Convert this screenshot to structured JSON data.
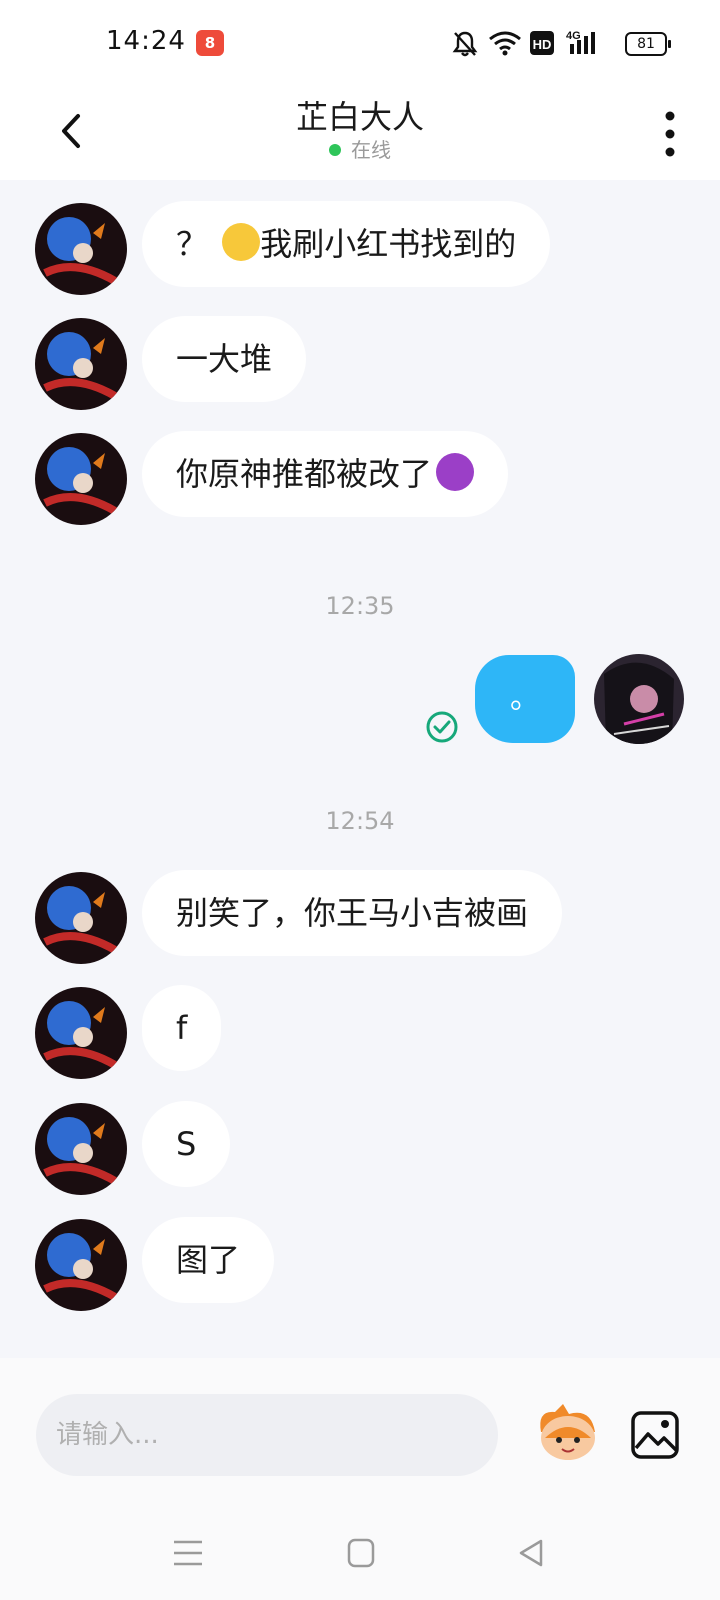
{
  "status_bar": {
    "time": "14:24",
    "app_badge": "8",
    "battery": "81",
    "network": "4G"
  },
  "header": {
    "title": "芷白大人",
    "presence": "在线"
  },
  "messages_group1": [
    {
      "text_before": "？",
      "emoji": "fearful-face",
      "text_after": "我刷小红书找到的"
    },
    {
      "text": "一大堆"
    },
    {
      "text": "你原神推都被改了",
      "emoji": "angry-devil-face"
    }
  ],
  "time1": "12:35",
  "sent_message": {
    "text": "。",
    "status": "sent",
    "status_color": "#16a87a",
    "bubble_color": "#2eb6f7"
  },
  "time2": "12:54",
  "messages_group2": [
    {
      "text": "别笑了，你王马小吉被画"
    },
    {
      "text": "f"
    },
    {
      "text": "S"
    },
    {
      "text": "图了"
    }
  ],
  "input": {
    "placeholder": "请输入..."
  },
  "colors": {
    "background": "#f5f6fa",
    "bubble": "#ffffff",
    "online": "#2ec55a"
  }
}
